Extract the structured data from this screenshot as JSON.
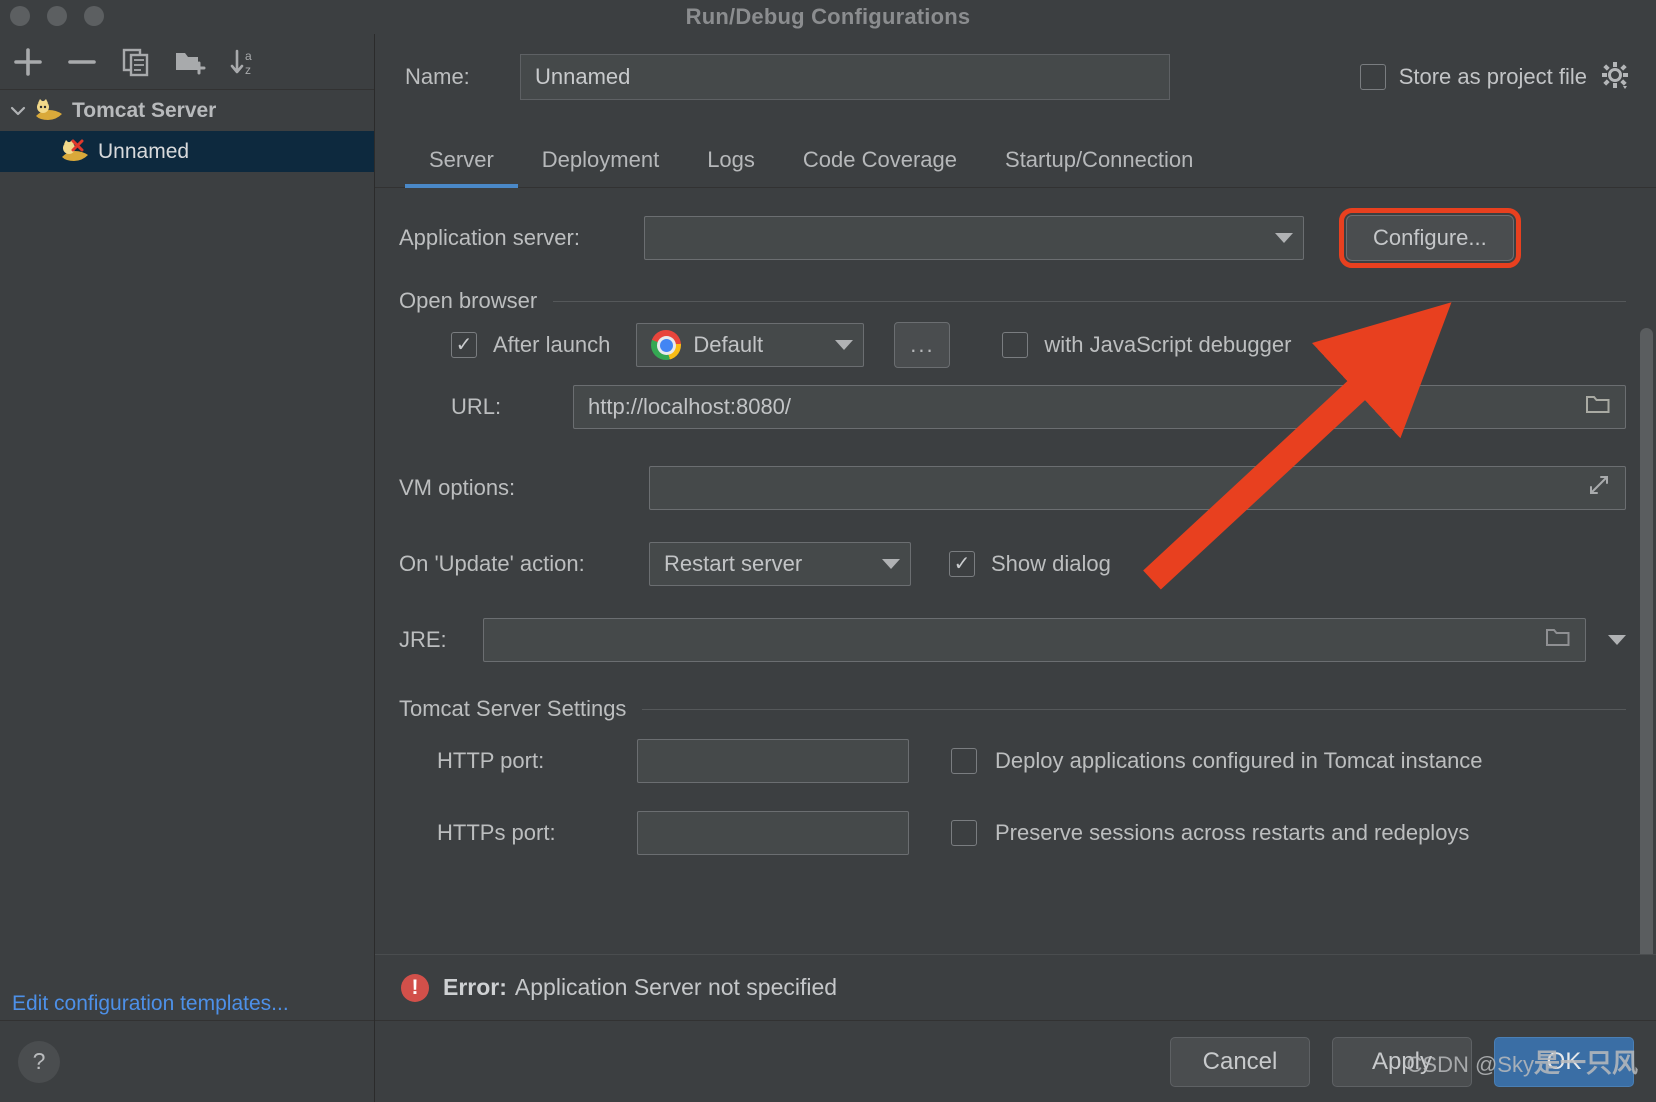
{
  "window": {
    "title": "Run/Debug Configurations"
  },
  "sidebar": {
    "toolbar": [
      {
        "name": "add-button",
        "glyph": "+"
      },
      {
        "name": "remove-button",
        "glyph": "−"
      },
      {
        "name": "copy-button",
        "glyph": "copy-icon"
      },
      {
        "name": "new-folder-button",
        "glyph": "folder-add-icon"
      },
      {
        "name": "sort-alphabetically-button",
        "glyph": "sort-az-icon"
      }
    ],
    "tree": [
      {
        "label": "Tomcat Server",
        "type": "group",
        "expanded": true
      },
      {
        "label": "Unnamed",
        "type": "item",
        "selected": true
      }
    ],
    "edit_templates_link": "Edit configuration templates...",
    "help_button": "?"
  },
  "header": {
    "name_label": "Name:",
    "name_value": "Unnamed",
    "store_as_project_file_label": "Store as project file",
    "store_as_project_file_checked": false,
    "gear_icon": "gear-icon"
  },
  "tabs": [
    {
      "label": "Server",
      "active": true
    },
    {
      "label": "Deployment",
      "active": false
    },
    {
      "label": "Logs",
      "active": false
    },
    {
      "label": "Code Coverage",
      "active": false
    },
    {
      "label": "Startup/Connection",
      "active": false
    }
  ],
  "server_tab": {
    "application_server": {
      "label": "Application server:",
      "value": "",
      "configure_button": "Configure...",
      "configure_highlighted": true
    },
    "open_browser": {
      "group_label": "Open browser",
      "after_launch_label": "After launch",
      "after_launch_checked": true,
      "browser_value": "Default",
      "browser_icon": "chrome-icon",
      "browse_button": "...",
      "js_debugger_label": "with JavaScript debugger",
      "js_debugger_checked": false,
      "url_label": "URL:",
      "url_value": "http://localhost:8080/",
      "url_folder_icon": "folder-icon"
    },
    "vm_options": {
      "label": "VM options:",
      "value": "",
      "expand_icon": "expand-icon"
    },
    "on_update_action": {
      "label": "On 'Update' action:",
      "value": "Restart server",
      "show_dialog_label": "Show dialog",
      "show_dialog_checked": true
    },
    "jre": {
      "label": "JRE:",
      "value": "",
      "folder_icon": "folder-icon",
      "dropdown_icon": "chevron-down-icon"
    },
    "tomcat_settings": {
      "group_label": "Tomcat Server Settings",
      "http_port_label": "HTTP port:",
      "http_port_value": "",
      "https_port_label": "HTTPs port:",
      "https_port_value": "",
      "deploy_checkbox_label": "Deploy applications configured in Tomcat instance",
      "deploy_checked": false,
      "preserve_checkbox_label": "Preserve sessions across restarts and redeploys",
      "preserve_checked": false
    }
  },
  "error": {
    "prefix": "Error:",
    "message": "Application Server not specified",
    "icon": "error-icon"
  },
  "footer": {
    "cancel": "Cancel",
    "apply": "Apply",
    "ok": "OK"
  },
  "watermark": {
    "prefix": "CSDN @Sky",
    "suffix": "是一只风"
  },
  "colors": {
    "accent": "#4a88c7",
    "highlight": "#e8401f",
    "link": "#4d90e8",
    "error": "#d2504a",
    "primary_button": "#3a6ea5",
    "selection": "#0d293e"
  }
}
